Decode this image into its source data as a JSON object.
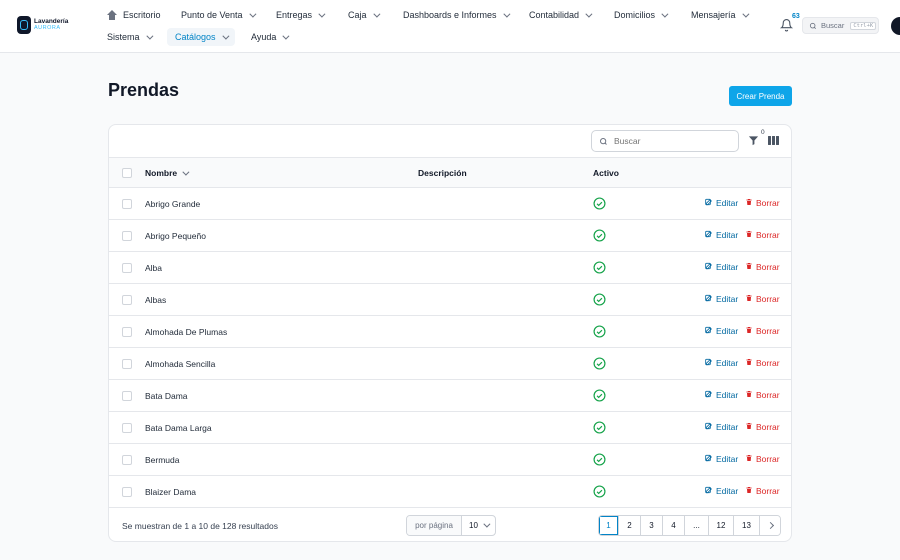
{
  "brand": {
    "line1": "Lavandería",
    "line2": "AURORA"
  },
  "nav": {
    "row1": [
      {
        "label": "Escritorio"
      },
      {
        "label": "Punto de Venta"
      },
      {
        "label": "Entregas"
      },
      {
        "label": "Caja"
      },
      {
        "label": "Dashboards e Informes"
      },
      {
        "label": "Contabilidad"
      },
      {
        "label": "Domicilios"
      },
      {
        "label": "Mensajería"
      }
    ],
    "row2": [
      {
        "label": "Sistema"
      },
      {
        "label": "Catálogos"
      },
      {
        "label": "Ayuda"
      }
    ]
  },
  "notifications": {
    "count": "63"
  },
  "global_search": {
    "label": "Buscar",
    "shortcut": "Ctrl+K"
  },
  "page": {
    "title": "Prendas",
    "create_label": "Crear Prenda"
  },
  "table": {
    "search_placeholder": "Buscar",
    "filter_count": "0",
    "headers": {
      "name": "Nombre",
      "description": "Descripción",
      "active": "Activo"
    },
    "edit_label": "Editar",
    "delete_label": "Borrar",
    "rows": [
      {
        "name": "Abrigo Grande"
      },
      {
        "name": "Abrigo Pequeño"
      },
      {
        "name": "Alba"
      },
      {
        "name": "Albas"
      },
      {
        "name": "Almohada De Plumas"
      },
      {
        "name": "Almohada Sencilla"
      },
      {
        "name": "Bata Dama"
      },
      {
        "name": "Bata Dama Larga"
      },
      {
        "name": "Bermuda"
      },
      {
        "name": "Blaizer Dama"
      }
    ]
  },
  "pagination": {
    "summary": "Se muestran de 1 a 10 de 128 resultados",
    "per_page_label": "por página",
    "per_page_value": "10",
    "pages": [
      "1",
      "2",
      "3",
      "4",
      "...",
      "12",
      "13"
    ]
  },
  "colors": {
    "accent": "#0ea5e9",
    "link": "#0369a1",
    "danger": "#dc2626",
    "success": "#16a34a"
  }
}
